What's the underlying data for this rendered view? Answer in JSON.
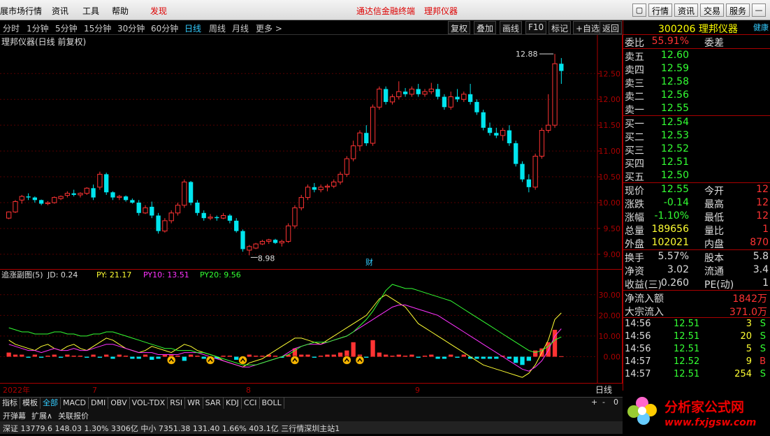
{
  "menubar": {
    "items": [
      "展市场行情",
      "资讯",
      "工具",
      "帮助"
    ],
    "discover": "发现",
    "center_left": "通达信金融终端",
    "center_right": "理邦仪器",
    "right_buttons": [
      "行情",
      "资讯",
      "交易",
      "服务"
    ]
  },
  "toolbar": {
    "periods": [
      "分时",
      "1分钟",
      "5分钟",
      "15分钟",
      "30分钟",
      "60分钟",
      "日线",
      "周线",
      "月线",
      "更多 >"
    ],
    "active_period": "日线",
    "buttons": [
      "复权",
      "叠加",
      "画线",
      "F10",
      "标记",
      "+自选",
      "返回"
    ]
  },
  "main_chart": {
    "title": "理邦仪器(日线 前复权)",
    "high_label": "12.88",
    "low_label": "8.98",
    "fin_marker": "财",
    "yticks": [
      "12.50",
      "12.00",
      "11.50",
      "11.00",
      "10.50",
      "10.00",
      "9.50",
      "9.00"
    ]
  },
  "sub_chart": {
    "title": "追涨副图(5)",
    "jd_label": "JD: 0.24",
    "py_label": "PY: 21.17",
    "py10_label": "PY10: 13.51",
    "py20_label": "PY20: 9.56",
    "yticks": [
      "30.00",
      "20.00",
      "10.00",
      "0.00"
    ]
  },
  "xaxis": {
    "labels": [
      "2022年",
      "7",
      "8",
      "9"
    ],
    "period": "日线",
    "controls": [
      "+",
      "-",
      "0"
    ]
  },
  "bottom_tabs": [
    "指标",
    "模板",
    "全部",
    "MACD",
    "DMI",
    "OBV",
    "VOL-TDX",
    "RSI",
    "WR",
    "SAR",
    "KDJ",
    "CCI",
    "BOLL"
  ],
  "bottom_tabs_active": "全部",
  "bottom_row2": [
    "开弹幕",
    "扩展∧",
    "关联报价"
  ],
  "status": "深证 13779.6  148.03  1.30%  3306亿  中小 7351.38  131.40  1.66%  403.1亿     三行情深圳主站1",
  "quote": {
    "code": "300206",
    "name": "理邦仪器",
    "tag": "健康",
    "weibi_label": "委比",
    "weibi": "55.91%",
    "weicha_label": "委差",
    "sell": [
      {
        "label": "卖五",
        "price": "12.60"
      },
      {
        "label": "卖四",
        "price": "12.59"
      },
      {
        "label": "卖三",
        "price": "12.58"
      },
      {
        "label": "卖二",
        "price": "12.56"
      },
      {
        "label": "卖一",
        "price": "12.55"
      }
    ],
    "buy": [
      {
        "label": "买一",
        "price": "12.54"
      },
      {
        "label": "买二",
        "price": "12.53"
      },
      {
        "label": "买三",
        "price": "12.52"
      },
      {
        "label": "买四",
        "price": "12.51"
      },
      {
        "label": "买五",
        "price": "12.50"
      }
    ],
    "stats": [
      {
        "l1": "现价",
        "v1": "12.55",
        "l2": "今开",
        "v2": "12"
      },
      {
        "l1": "涨跌",
        "v1": "-0.14",
        "l2": "最高",
        "v2": "12"
      },
      {
        "l1": "涨幅",
        "v1": "-1.10%",
        "l2": "最低",
        "v2": "12"
      },
      {
        "l1": "总量",
        "v1": "189656",
        "l2": "量比",
        "v2": "1"
      },
      {
        "l1": "外盘",
        "v1": "102021",
        "l2": "内盘",
        "v2": "870"
      }
    ],
    "fund": [
      {
        "l1": "换手",
        "v1": "5.57%",
        "l2": "股本",
        "v2": "5.8"
      },
      {
        "l1": "净资",
        "v1": "3.02",
        "l2": "流通",
        "v2": "3.4"
      },
      {
        "l1": "收益(三)",
        "v1": "0.260",
        "l2": "PE(动)",
        "v2": "1"
      }
    ],
    "flow": [
      {
        "label": "净流入额",
        "value": "1842万"
      },
      {
        "label": "大宗流入",
        "value": "371.0万"
      }
    ],
    "ticks": [
      {
        "time": "14:56",
        "price": "12.51",
        "vol": "3",
        "side": "S"
      },
      {
        "time": "14:56",
        "price": "12.51",
        "vol": "20",
        "side": "S"
      },
      {
        "time": "14:56",
        "price": "12.51",
        "vol": "5",
        "side": "S"
      },
      {
        "time": "14:57",
        "price": "12.52",
        "vol": "9",
        "side": "B"
      },
      {
        "time": "14:57",
        "price": "12.51",
        "vol": "254",
        "side": "S"
      }
    ]
  },
  "logo": {
    "text": "分析家公式网",
    "url": "www.fxjgsw.com"
  },
  "colors": {
    "up": "#ff3333",
    "down": "#00e5ee",
    "py": "#ffff33",
    "py10": "#ff33ff",
    "py20": "#33ff33"
  },
  "chart_data": {
    "type": "candlestick",
    "candles": [
      [
        9.7,
        9.83,
        9.68,
        9.82
      ],
      [
        9.82,
        10.05,
        9.8,
        10.02
      ],
      [
        10.05,
        10.15,
        9.98,
        10.12
      ],
      [
        10.12,
        10.18,
        10.05,
        10.1
      ],
      [
        10.1,
        10.12,
        10.0,
        10.05
      ],
      [
        10.05,
        10.06,
        9.95,
        9.98
      ],
      [
        9.98,
        10.03,
        9.95,
        10.0
      ],
      [
        10.0,
        10.12,
        9.98,
        10.1
      ],
      [
        10.08,
        10.14,
        10.05,
        10.12
      ],
      [
        10.14,
        10.22,
        10.1,
        10.18
      ],
      [
        10.18,
        10.25,
        10.12,
        10.15
      ],
      [
        10.15,
        10.2,
        10.1,
        10.18
      ],
      [
        10.18,
        10.3,
        10.15,
        10.28
      ],
      [
        10.28,
        10.35,
        10.05,
        10.1
      ],
      [
        10.3,
        10.6,
        10.25,
        10.55
      ],
      [
        10.55,
        10.58,
        10.15,
        10.2
      ],
      [
        10.2,
        10.22,
        10.05,
        10.1
      ],
      [
        10.1,
        10.15,
        10.05,
        10.12
      ],
      [
        10.12,
        10.14,
        10.02,
        10.05
      ],
      [
        10.05,
        10.08,
        9.98,
        10.0
      ],
      [
        10.0,
        10.05,
        9.75,
        9.8
      ],
      [
        9.8,
        9.95,
        9.78,
        9.9
      ],
      [
        9.92,
        10.02,
        9.7,
        9.75
      ],
      [
        9.75,
        9.8,
        9.4,
        9.45
      ],
      [
        9.45,
        9.7,
        9.42,
        9.65
      ],
      [
        9.65,
        9.85,
        9.6,
        9.8
      ],
      [
        9.8,
        10.0,
        9.75,
        9.95
      ],
      [
        9.95,
        10.45,
        9.9,
        10.4
      ],
      [
        10.4,
        10.42,
        9.95,
        10.0
      ],
      [
        10.0,
        10.05,
        9.75,
        9.8
      ],
      [
        9.8,
        9.85,
        9.65,
        9.7
      ],
      [
        9.7,
        9.78,
        9.66,
        9.72
      ],
      [
        9.72,
        9.75,
        9.65,
        9.7
      ],
      [
        9.7,
        9.8,
        9.68,
        9.75
      ],
      [
        9.75,
        9.78,
        9.6,
        9.65
      ],
      [
        9.65,
        9.7,
        9.42,
        9.45
      ],
      [
        9.45,
        9.48,
        9.05,
        9.1
      ],
      [
        9.08,
        9.18,
        8.98,
        9.15
      ],
      [
        9.12,
        9.22,
        9.1,
        9.2
      ],
      [
        9.2,
        9.28,
        9.18,
        9.25
      ],
      [
        9.25,
        9.3,
        9.2,
        9.28
      ],
      [
        9.28,
        9.3,
        9.2,
        9.22
      ],
      [
        9.22,
        9.28,
        9.15,
        9.25
      ],
      [
        9.25,
        9.6,
        9.22,
        9.55
      ],
      [
        9.55,
        9.95,
        9.5,
        9.9
      ],
      [
        9.9,
        10.15,
        9.85,
        10.1
      ],
      [
        10.1,
        10.35,
        10.05,
        10.3
      ],
      [
        10.3,
        10.38,
        10.2,
        10.25
      ],
      [
        10.25,
        10.35,
        10.2,
        10.3
      ],
      [
        10.3,
        10.36,
        10.22,
        10.32
      ],
      [
        10.32,
        10.45,
        10.28,
        10.4
      ],
      [
        10.4,
        10.6,
        10.35,
        10.55
      ],
      [
        10.55,
        10.9,
        10.5,
        10.85
      ],
      [
        10.85,
        11.2,
        10.8,
        11.1
      ],
      [
        11.1,
        11.4,
        11.0,
        11.35
      ],
      [
        11.35,
        11.5,
        11.1,
        11.15
      ],
      [
        11.15,
        11.9,
        11.1,
        11.85
      ],
      [
        11.85,
        12.25,
        11.8,
        12.2
      ],
      [
        12.2,
        12.25,
        11.9,
        11.95
      ],
      [
        11.95,
        12.1,
        11.9,
        12.05
      ],
      [
        12.05,
        12.35,
        12.0,
        12.15
      ],
      [
        12.15,
        12.22,
        12.05,
        12.1
      ],
      [
        12.1,
        12.25,
        12.05,
        12.2
      ],
      [
        12.2,
        12.3,
        12.05,
        12.1
      ],
      [
        12.1,
        12.2,
        12.05,
        12.15
      ],
      [
        12.15,
        12.32,
        12.1,
        12.2
      ],
      [
        12.2,
        12.3,
        12.0,
        12.05
      ],
      [
        12.05,
        12.1,
        11.8,
        11.85
      ],
      [
        11.85,
        12.15,
        11.8,
        12.05
      ],
      [
        12.05,
        12.2,
        11.95,
        12.0
      ],
      [
        12.0,
        12.15,
        11.95,
        12.1
      ],
      [
        12.1,
        12.3,
        11.9,
        11.95
      ],
      [
        11.95,
        12.0,
        11.7,
        11.75
      ],
      [
        11.75,
        11.8,
        11.4,
        11.45
      ],
      [
        11.45,
        11.55,
        11.3,
        11.35
      ],
      [
        11.35,
        11.45,
        11.25,
        11.3
      ],
      [
        11.3,
        11.45,
        11.2,
        11.4
      ],
      [
        11.4,
        11.5,
        11.1,
        11.15
      ],
      [
        11.15,
        11.2,
        10.7,
        10.75
      ],
      [
        10.75,
        10.8,
        10.4,
        10.45
      ],
      [
        10.45,
        10.55,
        10.2,
        10.3
      ],
      [
        10.3,
        10.95,
        10.25,
        10.9
      ],
      [
        10.9,
        11.45,
        10.85,
        11.4
      ],
      [
        11.4,
        12.1,
        11.35,
        11.5
      ],
      [
        11.5,
        12.88,
        11.45,
        12.69
      ],
      [
        12.69,
        12.8,
        12.3,
        12.55
      ]
    ],
    "ylim": [
      8.85,
      12.95
    ],
    "indicator": {
      "jd": [
        2,
        1,
        1,
        -0.5,
        1,
        -0.5,
        0.5,
        1,
        -0.5,
        1,
        0.5,
        0.5,
        -0.5,
        1,
        -0.5,
        1,
        -1,
        1,
        0.5,
        -1,
        -1,
        1,
        -1.5,
        -1,
        1,
        1,
        0.5,
        -2,
        1,
        0.5,
        -1,
        -1,
        -1,
        0.5,
        0.5,
        -1.5,
        -2,
        1,
        0.5,
        0.5,
        1,
        0.5,
        -0.5,
        1,
        4,
        1,
        1,
        -0.5,
        0.5,
        1,
        1,
        2,
        3,
        7,
        1,
        -0.5,
        8,
        2,
        1,
        0.5,
        1,
        0.5,
        1,
        -0.5,
        0.5,
        1,
        -1,
        -1,
        1,
        -0.5,
        1,
        -1,
        -1,
        -1,
        -1,
        -1,
        0.5,
        -1,
        -3,
        -4,
        -2,
        3,
        4,
        7,
        13,
        0.24
      ],
      "py": [
        8,
        6,
        5,
        4,
        3,
        5,
        6,
        4,
        3,
        5,
        6,
        4,
        3,
        5,
        7,
        9,
        8,
        6,
        4,
        3,
        2,
        3,
        5,
        4,
        3,
        2,
        4,
        6,
        5,
        3,
        2,
        1,
        0,
        -2,
        -3,
        -4,
        -5,
        -3,
        -2,
        -1,
        1,
        3,
        5,
        7,
        9,
        9,
        8,
        7,
        6,
        8,
        10,
        12,
        14,
        16,
        18,
        20,
        24,
        28,
        30,
        28,
        26,
        24,
        20,
        16,
        14,
        12,
        10,
        8,
        6,
        4,
        2,
        0,
        -2,
        -4,
        -5,
        -6,
        -7,
        -8,
        -9,
        -10,
        -8,
        -4,
        2,
        8,
        18,
        21.17
      ],
      "py10": [
        6,
        5,
        4,
        3,
        3,
        2,
        3,
        4,
        3,
        3,
        4,
        3,
        3,
        4,
        5,
        6,
        6,
        5,
        4,
        3,
        2,
        2,
        2,
        1,
        1,
        1,
        1,
        2,
        2,
        2,
        1,
        0,
        -1,
        -2,
        -3,
        -4,
        -5,
        -5,
        -4,
        -3,
        -2,
        -1,
        0,
        2,
        4,
        5,
        6,
        6,
        6,
        7,
        8,
        9,
        10,
        12,
        14,
        16,
        18,
        20,
        22,
        24,
        25,
        25,
        24,
        23,
        22,
        21,
        20,
        18,
        16,
        14,
        12,
        10,
        8,
        6,
        4,
        2,
        0,
        -2,
        -4,
        -6,
        -7,
        -5,
        -2,
        3,
        10,
        13.51
      ],
      "py20": [
        14,
        13,
        12,
        12,
        11,
        11,
        11,
        12,
        12,
        11,
        11,
        10,
        10,
        11,
        11,
        12,
        12,
        11,
        10,
        9,
        8,
        7,
        6,
        5,
        4,
        4,
        3,
        3,
        3,
        2,
        2,
        1,
        0,
        -1,
        -2,
        -3,
        -4,
        -4,
        -4,
        -3,
        -2,
        -1,
        0,
        1,
        3,
        5,
        6,
        7,
        7,
        7,
        8,
        9,
        10,
        12,
        15,
        18,
        22,
        27,
        32,
        35,
        34,
        33,
        33,
        32,
        31,
        30,
        29,
        28,
        27,
        25,
        23,
        21,
        19,
        17,
        15,
        13,
        11,
        9,
        7,
        5,
        3,
        2,
        3,
        5,
        8,
        9.56
      ],
      "signals": [
        25,
        31,
        36,
        44,
        52,
        54,
        104,
        110
      ],
      "ylim": [
        -12,
        36
      ]
    }
  }
}
